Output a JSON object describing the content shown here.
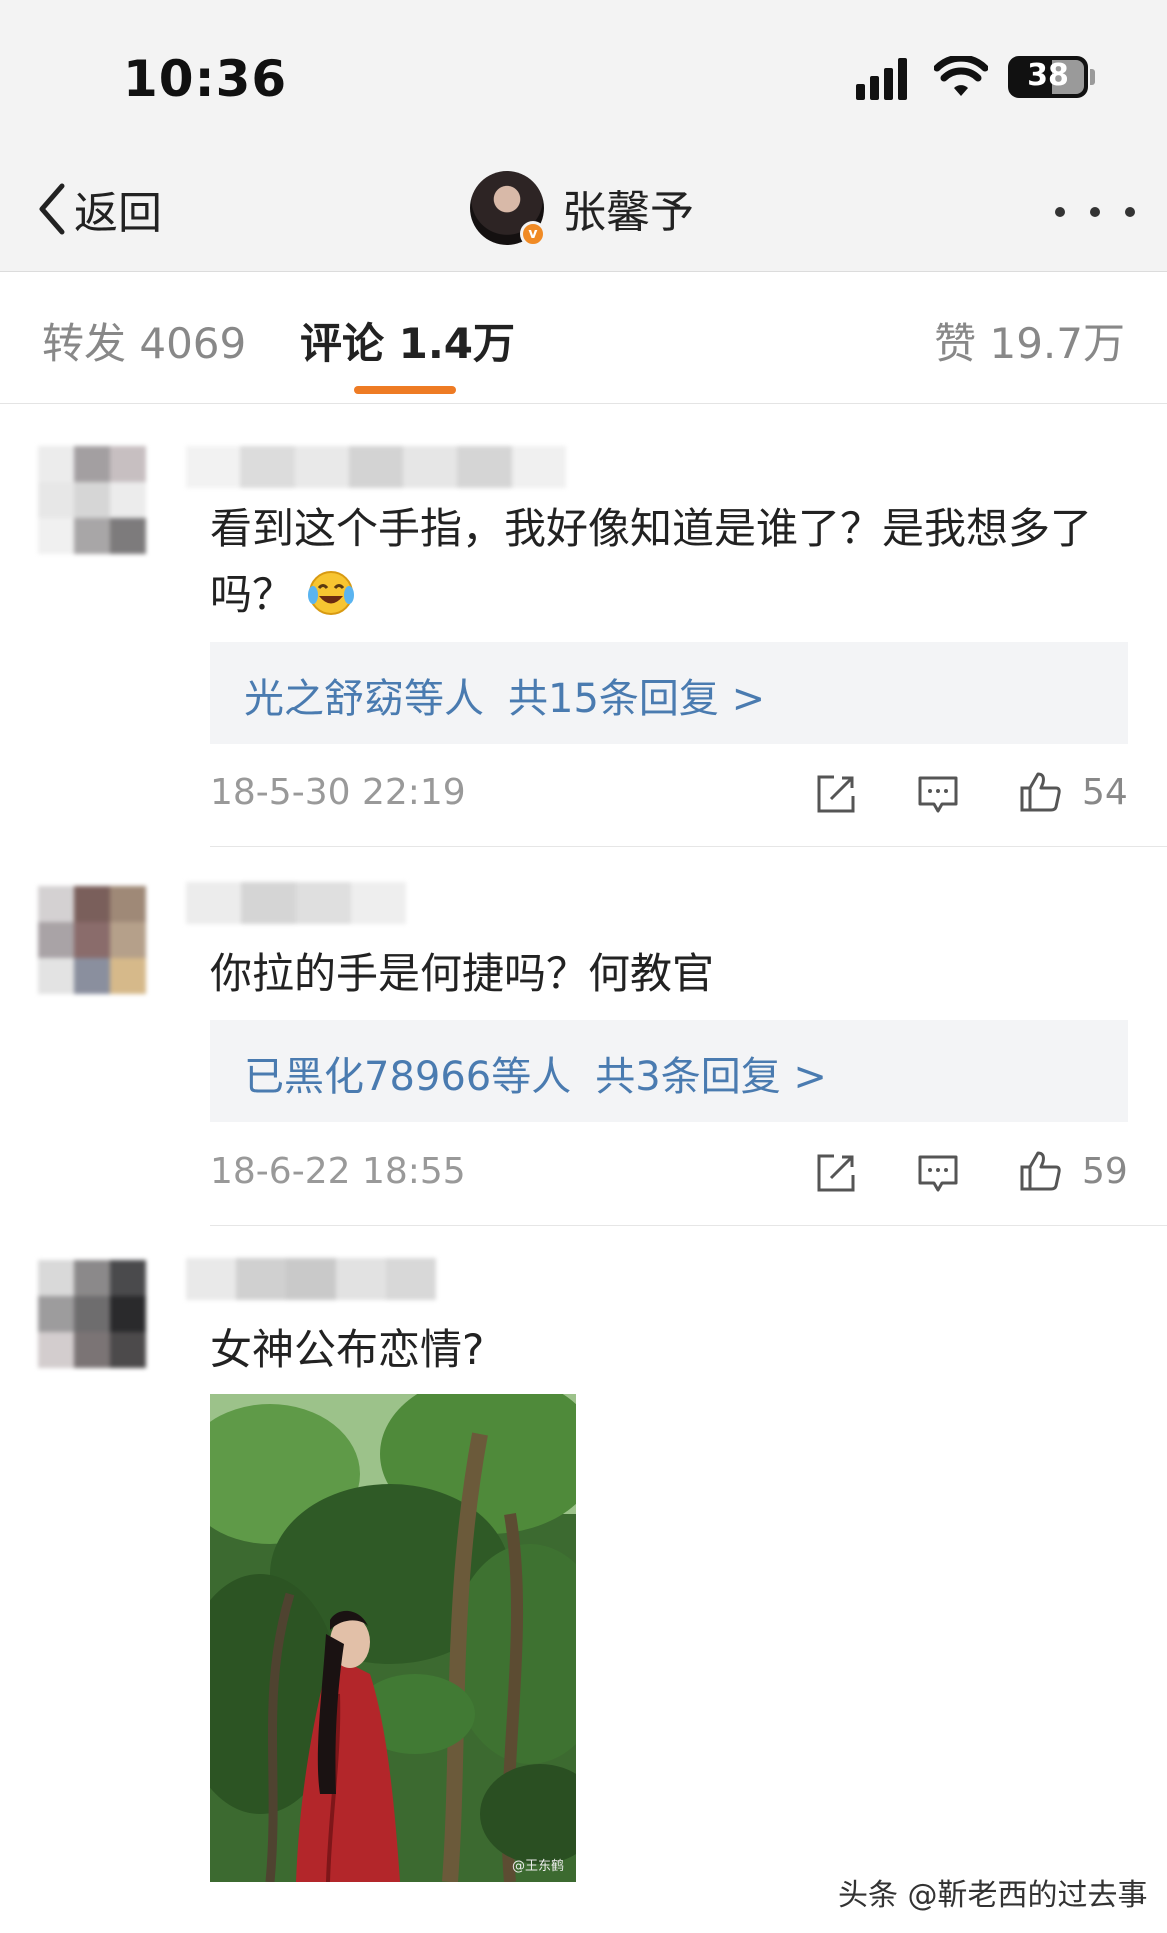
{
  "status_bar": {
    "time": "10:36",
    "battery": "38"
  },
  "nav": {
    "back_label": "返回",
    "title": "张馨予",
    "verified_badge": "v"
  },
  "tabs": [
    {
      "label": "转发 4069",
      "active": false
    },
    {
      "label": "评论 1.4万",
      "active": true
    },
    {
      "label": "赞 19.7万",
      "active": false
    }
  ],
  "accent_color": "#ee7b24",
  "link_color": "#4a7bb0",
  "comments": [
    {
      "text": "看到这个手指，我好像知道是谁了？是我想多了吗？",
      "emoji": "laughing-crying-emoji",
      "replies_users": "光之舒窈等人",
      "replies_count": "共15条回复 >",
      "time": "18-5-30 22:19",
      "likes": "54"
    },
    {
      "text": "你拉的手是何捷吗？何教官",
      "replies_users": "已黑化78966等人",
      "replies_count": "共3条回复 >",
      "time": "18-6-22 18:55",
      "likes": "59"
    },
    {
      "text": "女神公布恋情?",
      "photo_watermark": "@王东鹤"
    }
  ],
  "source_watermark": "头条 @靳老西的过去事",
  "icons": [
    "chevron-left-icon",
    "more-icon",
    "share-icon",
    "comment-icon",
    "like-icon"
  ]
}
